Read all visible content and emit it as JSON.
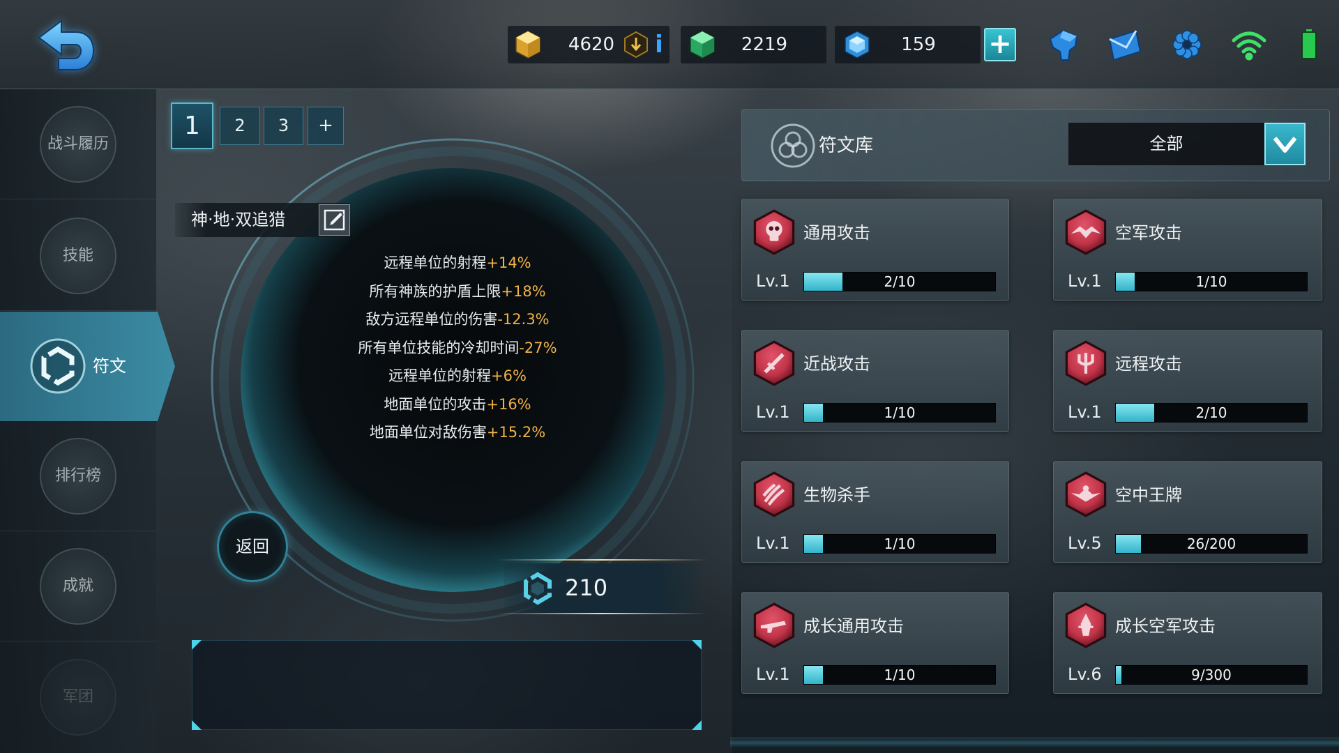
{
  "theme": {
    "accent": "#3fc4d6",
    "highlight": "#f0b347",
    "rune_red": "#c23448",
    "gold": "#f2c14e",
    "green": "#3ccf7a",
    "blue": "#3aa6e8"
  },
  "topbar": {
    "back_icon": "back-arrow-icon",
    "currencies": [
      {
        "name": "gold",
        "icon": "gold-hexagon-icon",
        "value": "4620"
      },
      {
        "name": "green",
        "icon": "green-cube-icon",
        "value": "2219"
      },
      {
        "name": "crystal",
        "icon": "blue-crystal-icon",
        "value": "159"
      }
    ],
    "info_label": "i",
    "add_label": "+",
    "status_icons": [
      "helmet-icon",
      "mail-icon",
      "settings-icon",
      "wifi-icon",
      "battery-icon"
    ]
  },
  "sidebar": {
    "items": [
      {
        "label": "战斗履历",
        "active": false
      },
      {
        "label": "技能",
        "active": false
      },
      {
        "label": "符文",
        "active": true,
        "icon": "rune-icon"
      },
      {
        "label": "排行榜",
        "active": false
      },
      {
        "label": "成就",
        "active": false
      },
      {
        "label": "军团",
        "active": false,
        "disabled": true
      }
    ]
  },
  "page_tabs": {
    "tabs": [
      "1",
      "2",
      "3"
    ],
    "add_label": "+",
    "selected": "1"
  },
  "rune_page": {
    "name": "神·地·双追猎",
    "edit_icon": "edit-icon",
    "stats": [
      {
        "text": "远程单位的射程",
        "value": "+14%"
      },
      {
        "text": "所有神族的护盾上限",
        "value": "+18%"
      },
      {
        "text": "敌方远程单位的伤害",
        "value": "-12.3%"
      },
      {
        "text": "所有单位技能的冷却时间",
        "value": "-27%"
      },
      {
        "text": "远程单位的射程",
        "value": "+6%"
      },
      {
        "text": "地面单位的攻击",
        "value": "+16%"
      },
      {
        "text": "地面单位对敌伤害",
        "value": "+15.2%"
      }
    ],
    "back_label": "返回",
    "points": "210",
    "points_icon": "rune-point-icon"
  },
  "library": {
    "title": "符文库",
    "icon": "rune-library-icon",
    "filter": "全部",
    "filter_icon": "chevron-down-icon",
    "runes": [
      {
        "name": "通用攻击",
        "icon": "skull-icon",
        "level": "Lv.1",
        "count": "2/10",
        "progress": 0.2
      },
      {
        "name": "空军攻击",
        "icon": "wing-beast-icon",
        "level": "Lv.1",
        "count": "1/10",
        "progress": 0.1
      },
      {
        "name": "近战攻击",
        "icon": "sword-icon",
        "level": "Lv.1",
        "count": "1/10",
        "progress": 0.1
      },
      {
        "name": "远程攻击",
        "icon": "trident-icon",
        "level": "Lv.1",
        "count": "2/10",
        "progress": 0.2
      },
      {
        "name": "生物杀手",
        "icon": "claw-icon",
        "level": "Lv.1",
        "count": "1/10",
        "progress": 0.1
      },
      {
        "name": "空中王牌",
        "icon": "ace-wing-icon",
        "level": "Lv.5",
        "count": "26/200",
        "progress": 0.13
      },
      {
        "name": "成长通用攻击",
        "icon": "rifle-icon",
        "level": "Lv.1",
        "count": "1/10",
        "progress": 0.1
      },
      {
        "name": "成长空军攻击",
        "icon": "spire-icon",
        "level": "Lv.6",
        "count": "9/300",
        "progress": 0.03
      }
    ]
  }
}
